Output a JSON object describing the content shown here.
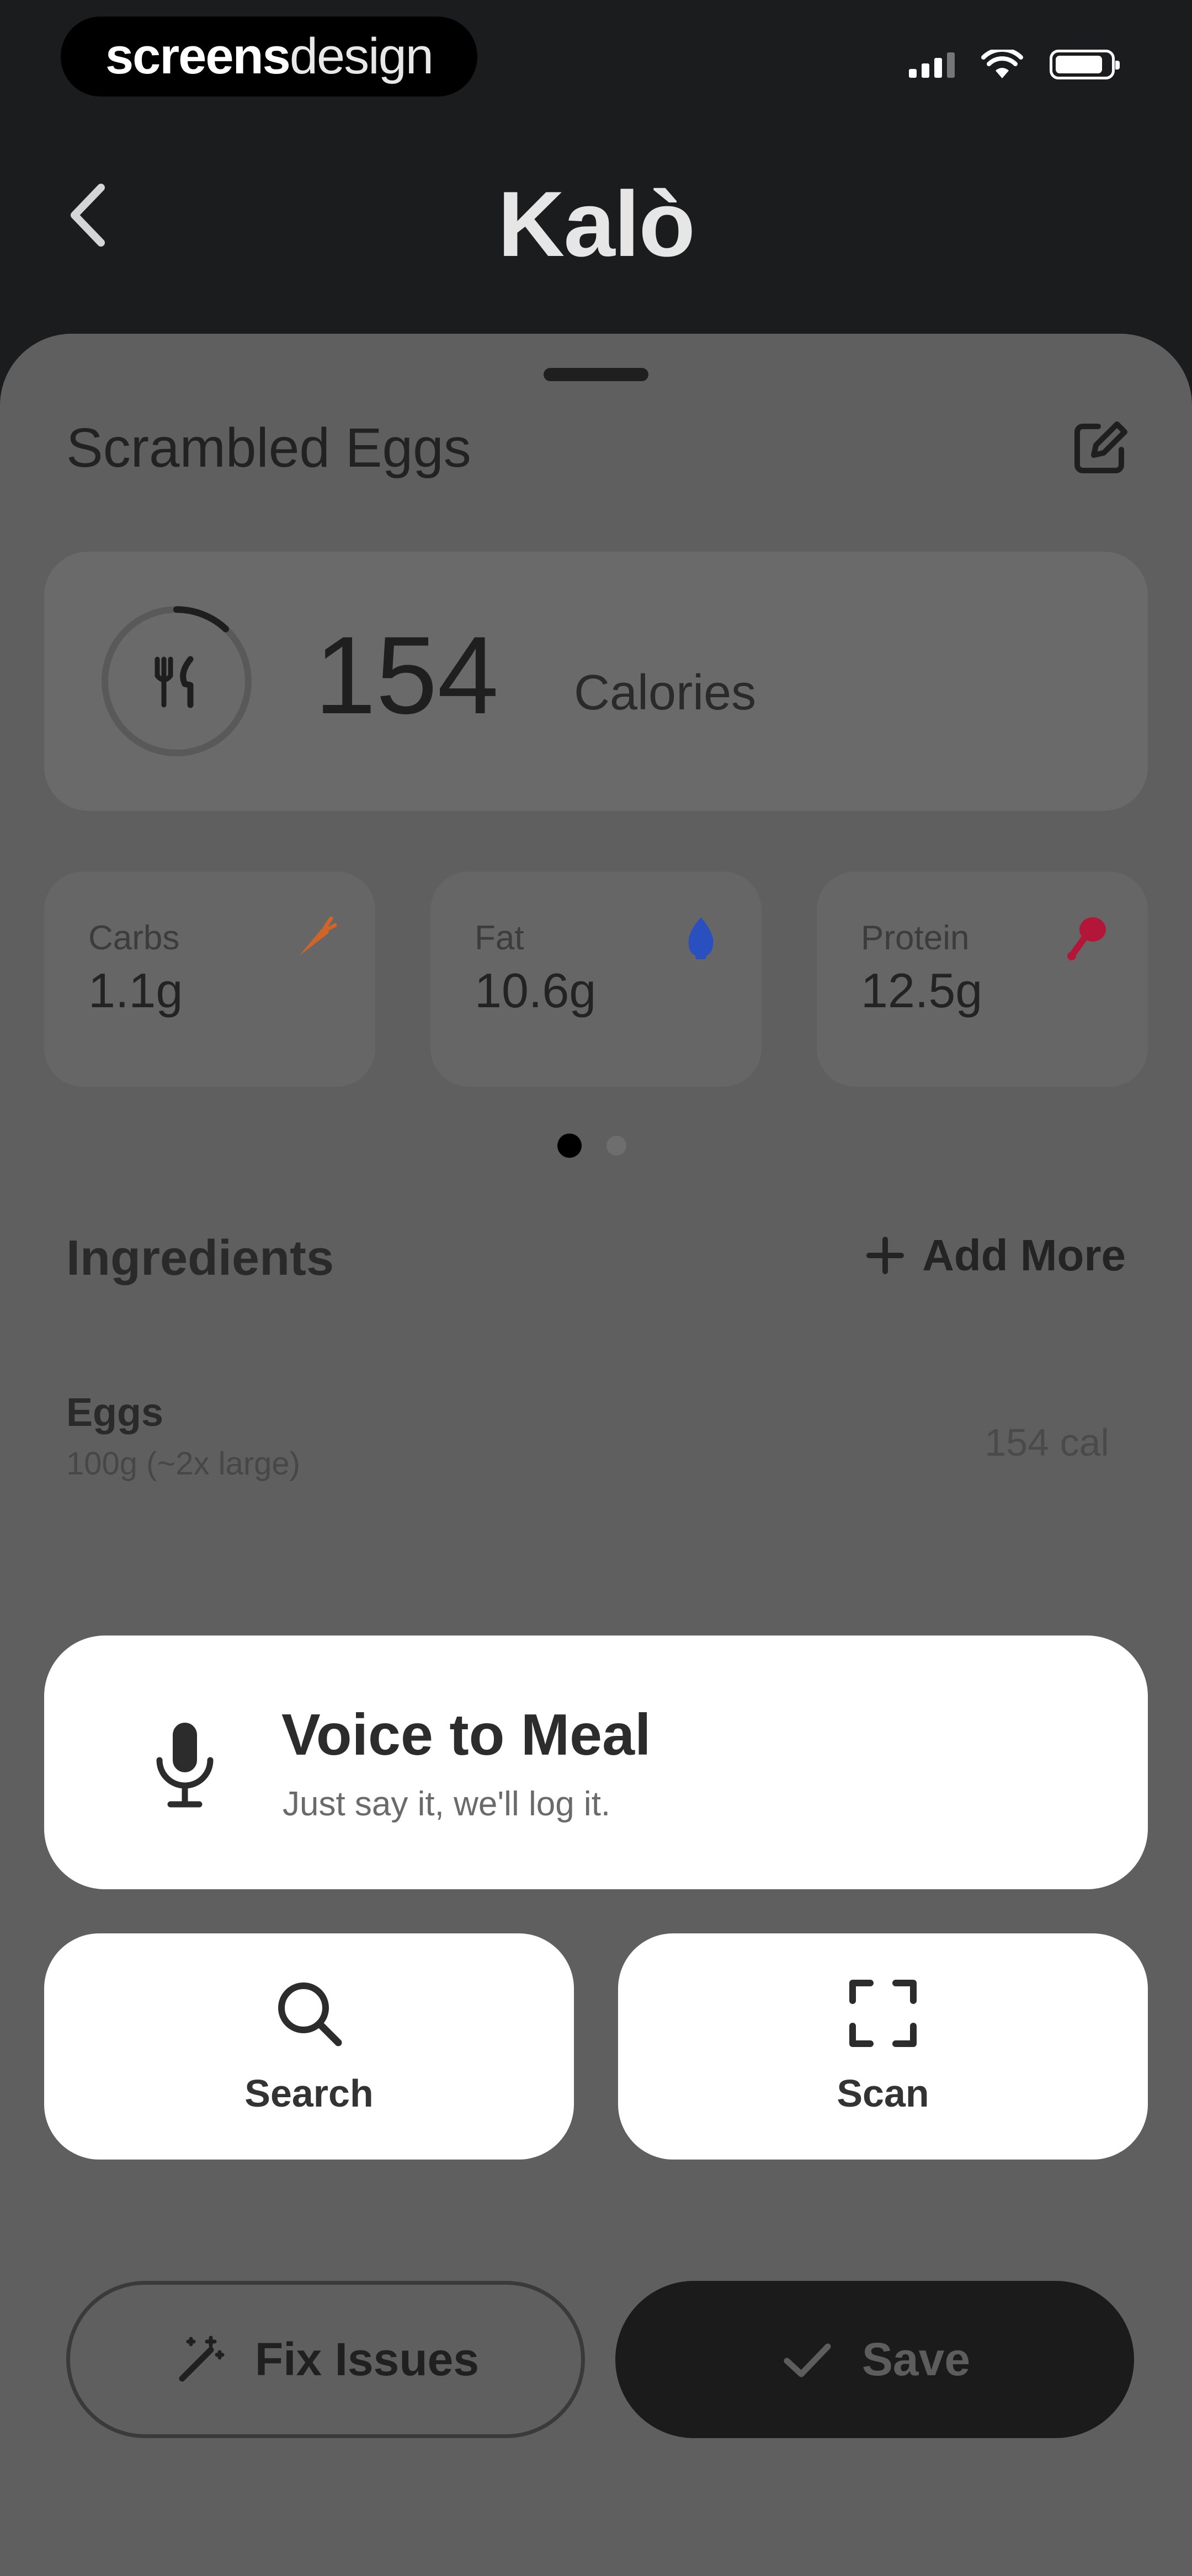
{
  "status_bar": {
    "brand_bold": "screens",
    "brand_light": "design"
  },
  "header": {
    "title": "Kalò"
  },
  "meal": {
    "name": "Scrambled Eggs",
    "calories": {
      "value": "154",
      "label": "Calories",
      "progress": 0.12
    },
    "macros": [
      {
        "label": "Carbs",
        "value": "1.1g",
        "icon": "carrot-icon",
        "color": "#d0652a"
      },
      {
        "label": "Fat",
        "value": "10.6g",
        "icon": "water-drop-icon",
        "color": "#2a4fbf"
      },
      {
        "label": "Protein",
        "value": "12.5g",
        "icon": "drumstick-icon",
        "color": "#b4163a"
      }
    ],
    "page_indicator": {
      "total": 2,
      "active": 1
    }
  },
  "ingredients": {
    "title": "Ingredients",
    "add_more_label": "Add More",
    "items": [
      {
        "name": "Eggs",
        "detail": "100g (~2x large)",
        "calories": "154 cal"
      }
    ]
  },
  "add_options": {
    "voice_title": "Voice to Meal",
    "voice_subtitle": "Just say it, we'll log it.",
    "search_label": "Search",
    "scan_label": "Scan"
  },
  "actions": {
    "fix_issues_label": "Fix Issues",
    "save_label": "Save"
  },
  "colors": {
    "background": "#1b1c1e",
    "sheet_overlay": "#5f5f60",
    "card": "#ffffff",
    "dark_button": "#1b1b1c"
  }
}
